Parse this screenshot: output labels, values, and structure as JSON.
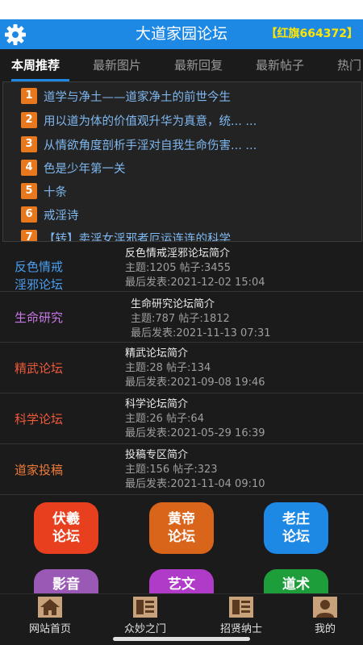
{
  "header": {
    "title": "大道家园论坛",
    "user_badge": "【红旗664372】"
  },
  "tabs": [
    {
      "label": "本周推荐"
    },
    {
      "label": "最新图片"
    },
    {
      "label": "最新回复"
    },
    {
      "label": "最新帖子"
    },
    {
      "label": "热门"
    }
  ],
  "hot_list": [
    {
      "num": "1",
      "title": "道学与净土——道家净土的前世今生"
    },
    {
      "num": "2",
      "title": "用以道为体的价值观升华为真意，统... ..."
    },
    {
      "num": "3",
      "title": "从情欲角度剖析手淫对自我生命伤害... ..."
    },
    {
      "num": "4",
      "title": "色是少年第一关"
    },
    {
      "num": "5",
      "title": "十条"
    },
    {
      "num": "6",
      "title": "戒淫诗"
    },
    {
      "num": "7",
      "title": "【转】卖淫女淫邪者厄运连连的科学... ..."
    }
  ],
  "forums": [
    {
      "name_line1": "反色情戒",
      "name_line2": "淫邪论坛",
      "name_color": "#4a9ef0",
      "intro": "反色情戒淫邪论坛简介",
      "stats": "主题:1205 帖子:3455",
      "last_post": "最后发表:2021-12-02 15:04"
    },
    {
      "name_line1": "生命研究",
      "name_line2": "",
      "name_color": "#c879e8",
      "intro": "生命研究论坛简介",
      "stats": "主题:787 帖子:1812",
      "last_post": "最后发表:2021-11-13 07:31"
    },
    {
      "name_line1": "精武论坛",
      "name_line2": "",
      "name_color": "#ee5a3a",
      "intro": "精武论坛简介",
      "stats": "主题:28 帖子:134",
      "last_post": "最后发表:2021-09-08 19:46"
    },
    {
      "name_line1": "科学论坛",
      "name_line2": "",
      "name_color": "#ee5a3a",
      "intro": "科学论坛简介",
      "stats": "主题:26 帖子:64",
      "last_post": "最后发表:2021-05-29 16:39"
    },
    {
      "name_line1": "道家投稿",
      "name_line2": "",
      "name_color": "#ee7a3a",
      "intro": "投稿专区简介",
      "stats": "主题:156 帖子:323",
      "last_post": "最后发表:2021-11-04 09:10"
    }
  ],
  "grid": [
    {
      "line1": "伏羲",
      "line2": "论坛",
      "color": "#e8401e"
    },
    {
      "line1": "黄帝",
      "line2": "论坛",
      "color": "#d9651a"
    },
    {
      "line1": "老庄",
      "line2": "论坛",
      "color": "#1e88e5"
    },
    {
      "line1": "影音",
      "line2": "",
      "color": "#9b59b6"
    },
    {
      "line1": "艺文",
      "line2": "",
      "color": "#b03bc8"
    },
    {
      "line1": "道术",
      "line2": "",
      "color": "#1e9e3a"
    }
  ],
  "nav": [
    {
      "label": "网站首页",
      "icon": "home-icon"
    },
    {
      "label": "众妙之门",
      "icon": "document-icon"
    },
    {
      "label": "招贤纳士",
      "icon": "document-icon"
    },
    {
      "label": "我的",
      "icon": "person-icon"
    }
  ],
  "colors": {
    "appbar": "#1e88e5",
    "badge": "#e8781e",
    "link": "#7fb8f0"
  }
}
